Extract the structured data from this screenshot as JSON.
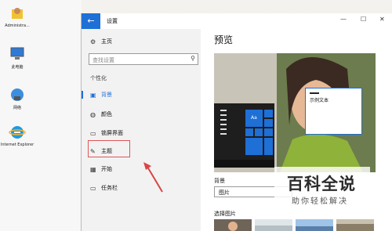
{
  "desktop": {
    "icons": [
      {
        "label": "Administra...",
        "icon": "user-folder-icon"
      },
      {
        "label": "此电脑",
        "icon": "computer-icon"
      },
      {
        "label": "网络",
        "icon": "network-icon"
      },
      {
        "label": "Internet Explorer",
        "icon": "internet-explorer-icon"
      }
    ]
  },
  "window": {
    "title": "设置",
    "back_icon": "←",
    "controls": {
      "minimize": "—",
      "maximize": "☐",
      "close": "✕"
    }
  },
  "sidebar": {
    "home": {
      "label": "主页",
      "icon": "gear-icon"
    },
    "search_placeholder": "查找设置",
    "section": "个性化",
    "items": [
      {
        "label": "背景",
        "icon": "picture-icon",
        "selected": true
      },
      {
        "label": "颜色",
        "icon": "palette-icon",
        "selected": false
      },
      {
        "label": "锁屏界面",
        "icon": "lock-screen-icon",
        "selected": false
      },
      {
        "label": "主题",
        "icon": "theme-icon",
        "selected": false
      },
      {
        "label": "开始",
        "icon": "start-icon",
        "selected": false
      },
      {
        "label": "任务栏",
        "icon": "taskbar-icon",
        "selected": false
      }
    ]
  },
  "main": {
    "preview_title": "预览",
    "sample_text": "示例文本",
    "tile_text": "Aa",
    "background_label": "背景",
    "background_value": "图片",
    "choose_picture_label": "选择图片"
  },
  "watermark": {
    "title": "百科全说",
    "subtitle": "助你轻松解决"
  },
  "colors": {
    "accent": "#1e6fd6",
    "highlight": "#e05555"
  }
}
